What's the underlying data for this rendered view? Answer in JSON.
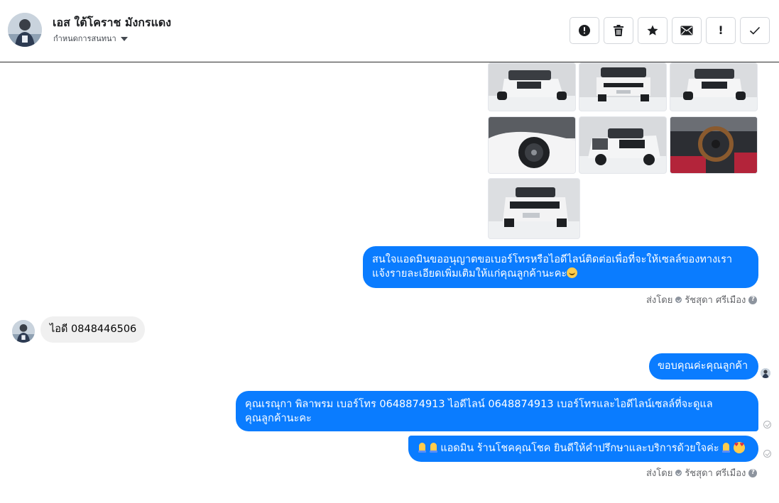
{
  "header": {
    "contact_name": "เอส ใต้โคราช มังกรแดง",
    "assign_label": "กำหนดการสนทนา",
    "actions": [
      {
        "name": "report-button",
        "icon": "alert-circle-icon"
      },
      {
        "name": "delete-button",
        "icon": "trash-icon"
      },
      {
        "name": "star-button",
        "icon": "star-icon"
      },
      {
        "name": "mark-unread-button",
        "icon": "envelope-icon"
      },
      {
        "name": "important-button",
        "icon": "exclamation-icon",
        "label": "!"
      },
      {
        "name": "done-button",
        "icon": "check-icon"
      }
    ]
  },
  "thread": {
    "photos_count_shown": 7,
    "messages": {
      "m1": {
        "line1": "สนใจแอดมินขออนุญาตขอเบอร์โทรหรือไอดีไลน์ติดต่อเพื่อที่จะให้เซลล์ของทางเรา",
        "line2": "แจ้งรายละเอียดเพิ่มเติมให้แก่คุณลูกค้านะคะ"
      },
      "sent_by_label": "ส่งโดย",
      "sent_by_name": "รัชสุดา ศรีเมือง",
      "help": "?",
      "incoming": {
        "text": "ไอดี  0848446506"
      },
      "m2": {
        "text": "ขอบคุณค่ะคุณลูกค้า"
      },
      "m3": {
        "line1": "คุณเรณุกา พิลาพรม        เบอร์โทร 0648874913  ไอดีไลน์ 0648874913  เบอร์โทรและไอดีไลน์เซลล์ที่จะดูแล",
        "line2": "คุณลูกค้านะคะ"
      },
      "m4": {
        "text": "แอดมิน ร้านโชคคุณโชค ยินดีให้คำปรึกษาและบริการด้วยใจค่ะ"
      },
      "sent_by_label2": "ส่งโดย",
      "sent_by_name2": "รัชสุดา ศรีเมือง"
    }
  },
  "colors": {
    "outgoing_bubble": "#0a7cff",
    "incoming_bubble": "#f0f0f0",
    "meta_text": "#65676b"
  }
}
